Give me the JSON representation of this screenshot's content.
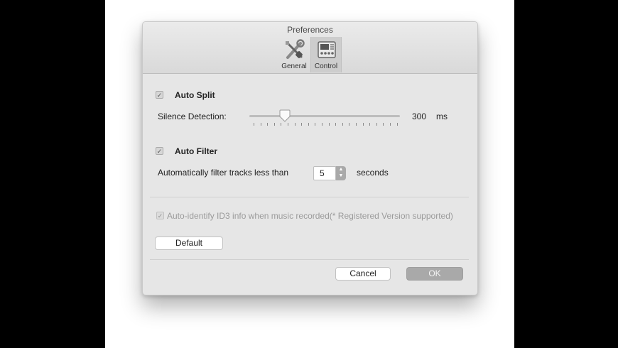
{
  "window": {
    "title": "Preferences"
  },
  "toolbar": {
    "tabs": [
      {
        "label": "General",
        "icon": "tools-icon",
        "selected": false
      },
      {
        "label": "Control",
        "icon": "control-panel-icon",
        "selected": true
      }
    ]
  },
  "auto_split": {
    "checkbox_label": "Auto Split",
    "checked": true,
    "silence_label": "Silence Detection:",
    "slider_value": "300",
    "slider_unit": "ms"
  },
  "auto_filter": {
    "checkbox_label": "Auto Filter",
    "checked": true,
    "filter_label": "Automatically filter tracks less than",
    "stepper_value": "5",
    "unit_label": "seconds"
  },
  "id3": {
    "checkbox_label": "Auto-identify ID3 info when music recorded(* Registered Version supported)",
    "checked": true,
    "enabled": false
  },
  "buttons": {
    "default_label": "Default",
    "cancel_label": "Cancel",
    "ok_label": "OK"
  },
  "colors": {
    "ok_button": "#a9a9a9",
    "dialog_bg": "#e6e6e6"
  }
}
